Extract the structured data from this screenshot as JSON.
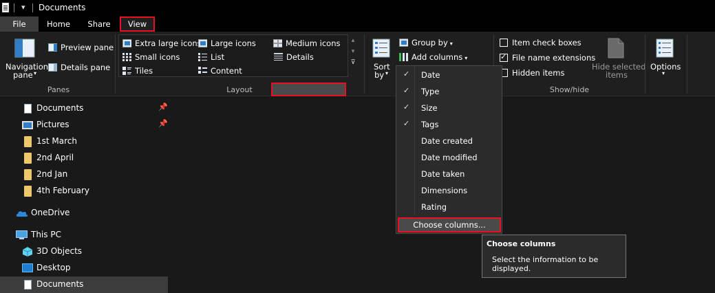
{
  "window": {
    "title": "Documents",
    "qat_arrow": "▾"
  },
  "tabs": [
    {
      "label": "File"
    },
    {
      "label": "Home"
    },
    {
      "label": "Share"
    },
    {
      "label": "View"
    }
  ],
  "ribbon": {
    "panes": {
      "navigation_pane_line1": "Navigation",
      "navigation_pane_line2": "pane",
      "preview_pane": "Preview pane",
      "details_pane": "Details pane",
      "group_label": "Panes"
    },
    "layout": {
      "extra_large_icons": "Extra large icons",
      "large_icons": "Large icons",
      "medium_icons": "Medium icons",
      "small_icons": "Small icons",
      "list": "List",
      "details": "Details",
      "tiles": "Tiles",
      "content": "Content",
      "group_label": "Layout"
    },
    "current_view": {
      "sort_by_line1": "Sort",
      "sort_by_line2": "by",
      "group_by": "Group by",
      "add_columns": "Add columns"
    },
    "show_hide": {
      "item_check_boxes": "Item check boxes",
      "file_name_extensions": "File name extensions",
      "hidden_items": "Hidden items",
      "hide_selected_line1": "Hide selected",
      "hide_selected_line2": "items",
      "group_label": "Show/hide",
      "item_check_boxes_checked": false,
      "file_name_extensions_checked": true,
      "hidden_items_checked": false
    },
    "options": {
      "label": "Options"
    }
  },
  "nav": {
    "items": [
      {
        "label": "Documents",
        "icon": "document-icon",
        "pinned": true
      },
      {
        "label": "Pictures",
        "icon": "pictures-icon",
        "pinned": true
      },
      {
        "label": "1st March",
        "icon": "folder-icon"
      },
      {
        "label": "2nd April",
        "icon": "folder-icon"
      },
      {
        "label": "2nd Jan",
        "icon": "folder-icon"
      },
      {
        "label": "4th February",
        "icon": "folder-icon"
      },
      {
        "label": "OneDrive",
        "icon": "onedrive-icon"
      },
      {
        "label": "This PC",
        "icon": "this-pc-icon"
      },
      {
        "label": "3D Objects",
        "icon": "3d-objects-icon"
      },
      {
        "label": "Desktop",
        "icon": "desktop-icon"
      },
      {
        "label": "Documents",
        "icon": "document-icon",
        "selected": true
      }
    ]
  },
  "columns_menu": {
    "items": [
      {
        "label": "Date",
        "checked": true
      },
      {
        "label": "Type",
        "checked": true
      },
      {
        "label": "Size",
        "checked": true
      },
      {
        "label": "Tags",
        "checked": true
      },
      {
        "label": "Date created",
        "checked": false
      },
      {
        "label": "Date modified",
        "checked": false
      },
      {
        "label": "Date taken",
        "checked": false
      },
      {
        "label": "Dimensions",
        "checked": false
      },
      {
        "label": "Rating",
        "checked": false
      }
    ],
    "choose_columns": "Choose columns..."
  },
  "tooltip": {
    "title": "Choose columns",
    "body": "Select the information to be displayed."
  },
  "colors": {
    "highlight_red": "#e81123",
    "folder_yellow": "#ecc86a",
    "background": "#191919"
  }
}
